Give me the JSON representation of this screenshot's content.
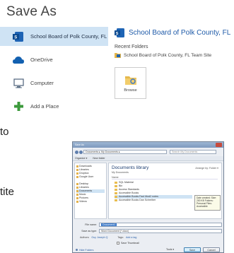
{
  "title": "Save As",
  "places": [
    {
      "label": "School Board of Polk County, FL",
      "icon": "sharepoint-icon",
      "selected": true
    },
    {
      "label": "OneDrive",
      "icon": "cloud-icon",
      "selected": false
    },
    {
      "label": "Computer",
      "icon": "computer-icon",
      "selected": false
    },
    {
      "label": "Add a Place",
      "icon": "plus-icon",
      "selected": false
    }
  ],
  "location": {
    "heading": "School Board of Polk County, FL",
    "recent_label": "Recent Folders",
    "recent_item": "School Board of Polk County, FL Team Site",
    "browse_label": "Browse"
  },
  "fragments": [
    "to",
    "tite"
  ],
  "dialog": {
    "window_title": "Save As",
    "path": "Documents ▸ My Documents ▸",
    "search_placeholder": "Search My Documents",
    "organize": "Organize ▾",
    "new_folder": "New folder",
    "nav_items": [
      "Downloads",
      "Libraries",
      "Dropbox",
      "Google User",
      "",
      "Desktop",
      "Libraries",
      "Documents",
      "Music",
      "Pictures",
      "Videos"
    ],
    "library_title": "Documents library",
    "library_sub": "My Documents",
    "arrange": "Arrange by:  Folder ▾",
    "col_name": "Name",
    "files": [
      "SQL Material",
      "Bin",
      "Access Standards",
      "Accessible Books",
      "Accessible Books Fact Mod2 notes",
      "Accessible Books Dan Schreiber"
    ],
    "tooltip": "Date created: Size: 200 KB Folders: Personal Files: Accessible",
    "filename_label": "File name:",
    "filename_value": "Document1",
    "type_label": "Save as type:",
    "type_value": "Word Document (*.docx)",
    "authors_label": "Authors:",
    "authors_value": "Guy Joseph Q",
    "tags_label": "Tags:",
    "tags_value": "Add a tag",
    "thumbnail": "Save Thumbnail",
    "hide_folders": "Hide Folders",
    "tools": "Tools ▾",
    "save": "Save",
    "cancel": "Cancel"
  }
}
